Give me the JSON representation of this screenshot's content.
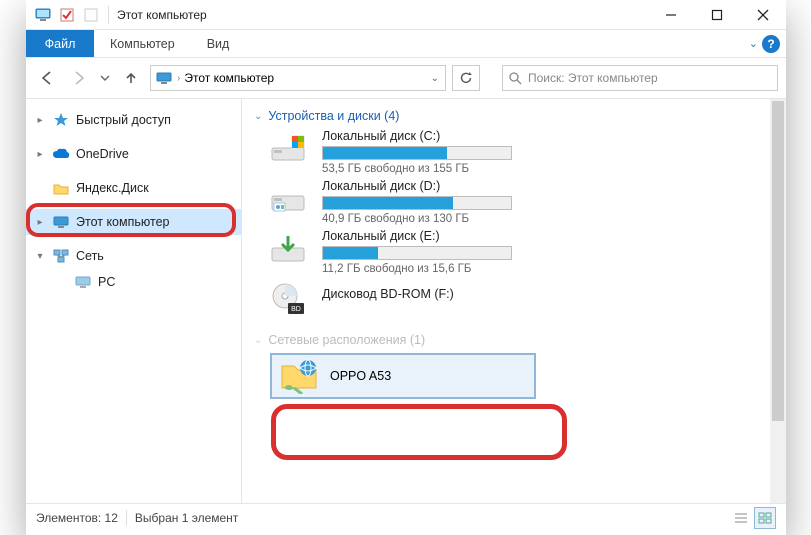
{
  "window": {
    "title": "Этот компьютер"
  },
  "ribbon": {
    "file": "Файл",
    "tabs": [
      "Компьютер",
      "Вид"
    ]
  },
  "breadcrumb": {
    "current": "Этот компьютер"
  },
  "search": {
    "placeholder": "Поиск: Этот компьютер"
  },
  "sidebar": {
    "items": [
      {
        "label": "Быстрый доступ",
        "caret": "▸"
      },
      {
        "label": "OneDrive",
        "caret": "▸"
      },
      {
        "label": "Яндекс.Диск",
        "caret": ""
      },
      {
        "label": "Этот компьютер",
        "caret": "▸",
        "selected": true
      },
      {
        "label": "Сеть",
        "caret": "▾"
      }
    ],
    "network_child": {
      "label": "PC"
    }
  },
  "groups": {
    "devices": {
      "title": "Устройства и диски (4)"
    },
    "network": {
      "title": "Сетевые расположения (1)"
    }
  },
  "drives": [
    {
      "name": "Локальный диск (C:)",
      "stat": "53,5 ГБ свободно из 155 ГБ",
      "fill": 66
    },
    {
      "name": "Локальный диск (D:)",
      "stat": "40,9 ГБ свободно из 130 ГБ",
      "fill": 69
    },
    {
      "name": "Локальный диск (E:)",
      "stat": "11,2 ГБ свободно из 15,6 ГБ",
      "fill": 29
    },
    {
      "name": "Дисковод BD-ROM (F:)",
      "stat": "",
      "fill": 0
    }
  ],
  "network_item": {
    "label": "OPPO A53"
  },
  "status": {
    "count": "Элементов: 12",
    "selection": "Выбран 1 элемент"
  }
}
